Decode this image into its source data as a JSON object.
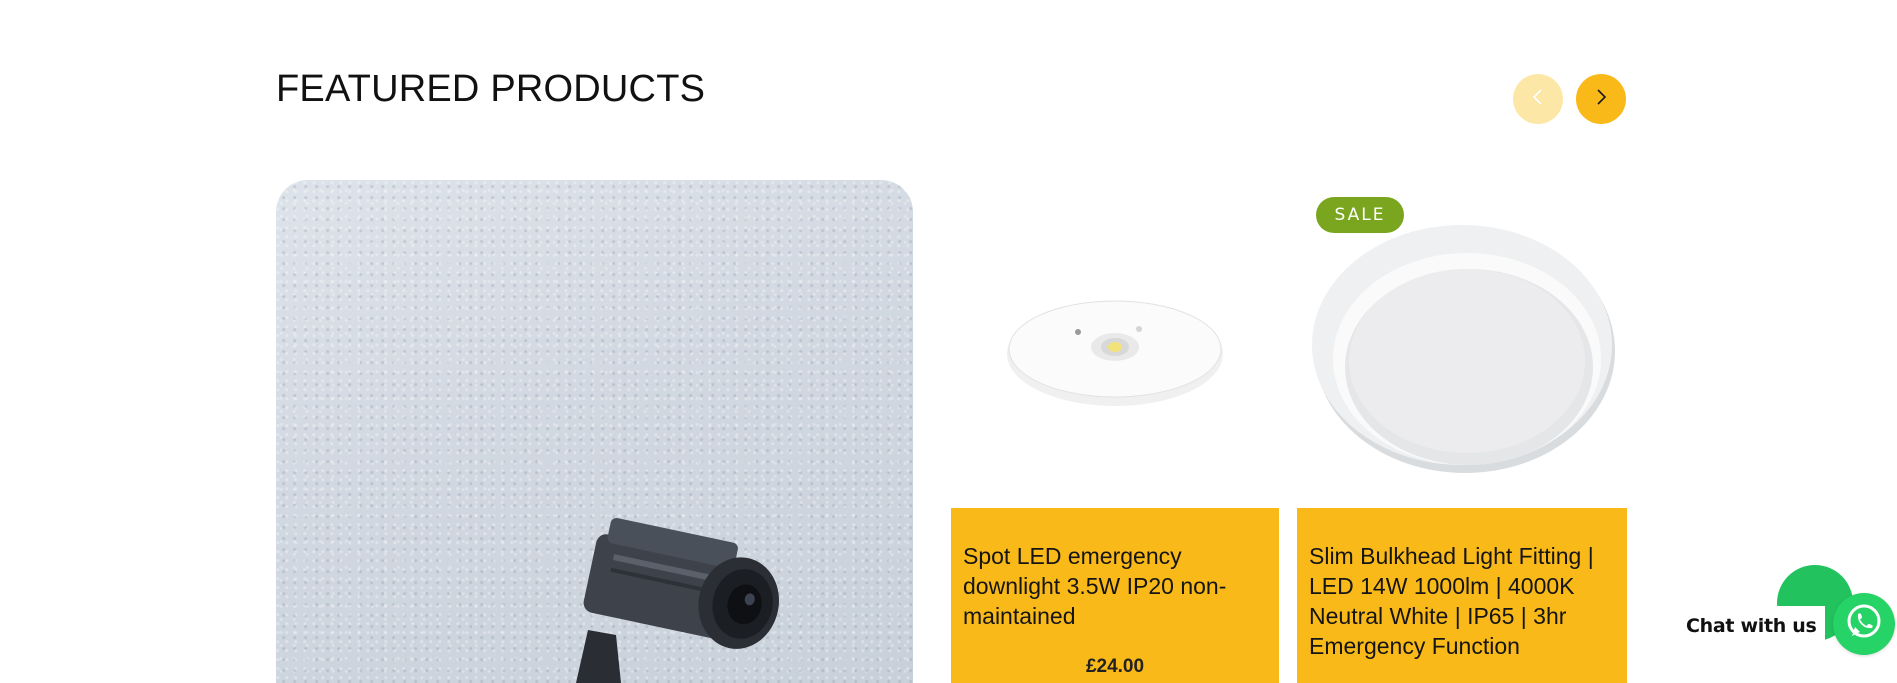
{
  "section": {
    "title": "FEATURED PRODUCTS"
  },
  "carousel": {
    "prev_icon": "chevron-left-icon",
    "next_icon": "chevron-right-icon",
    "prev_color": "#fde7a6",
    "next_color": "#f9b919"
  },
  "products": [
    {
      "name": "Spot LED emergency downlight 3.5W IP20 non-maintained",
      "price": "£24.00",
      "badge": ""
    },
    {
      "name": "Slim Bulkhead Light Fitting | LED 14W 1000lm | 4000K Neutral White | IP65 | 3hr Emergency Function",
      "price": "",
      "badge": "SALE"
    }
  ],
  "chat": {
    "label": "Chat with us",
    "icon": "whatsapp-icon",
    "color": "#25d366"
  },
  "colors": {
    "accent": "#f9b919",
    "sale": "#7aa51f"
  }
}
